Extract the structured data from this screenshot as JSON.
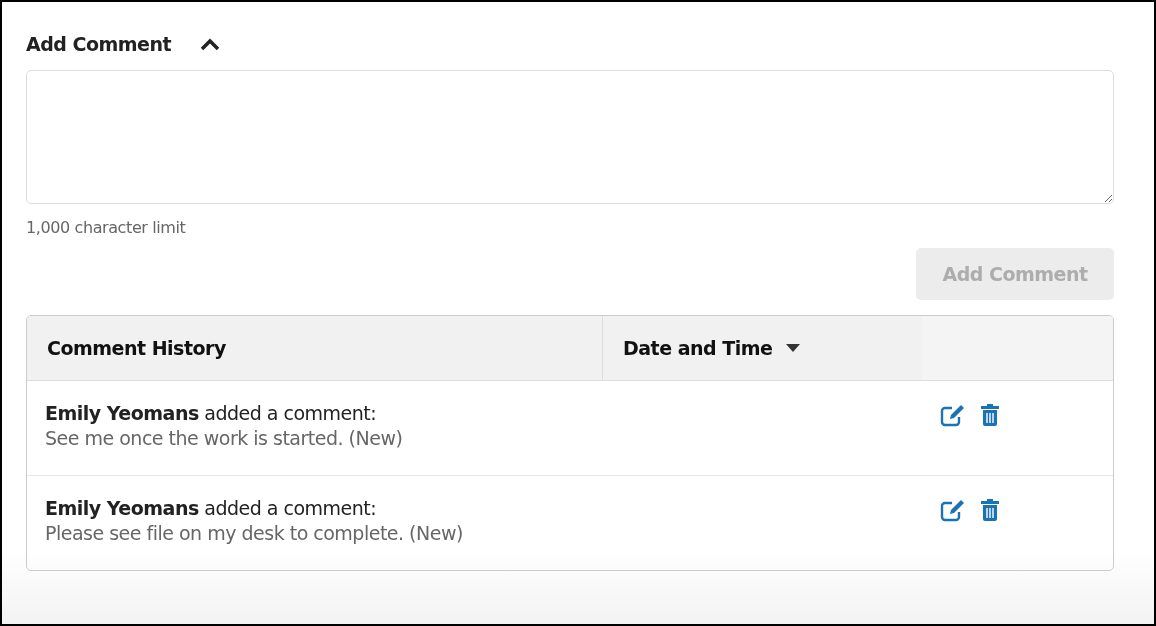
{
  "add_comment": {
    "title": "Add Comment",
    "expanded": true,
    "limit_note": "1,000 character limit",
    "button": {
      "label": "Add Comment",
      "disabled": true
    }
  },
  "comment_history": {
    "columns": [
      {
        "label": "Comment History",
        "sortable": false
      },
      {
        "label": "Date and Time",
        "sortable": true
      }
    ],
    "rows": [
      {
        "header": "**Emily Yeomans** added a comment:",
        "text": "See me once the work is started. (New)"
      },
      {
        "header": "**Emily Yeomans** added a comment:",
        "text": "Please see file on my desk to complete. (New)"
      }
    ]
  }
}
